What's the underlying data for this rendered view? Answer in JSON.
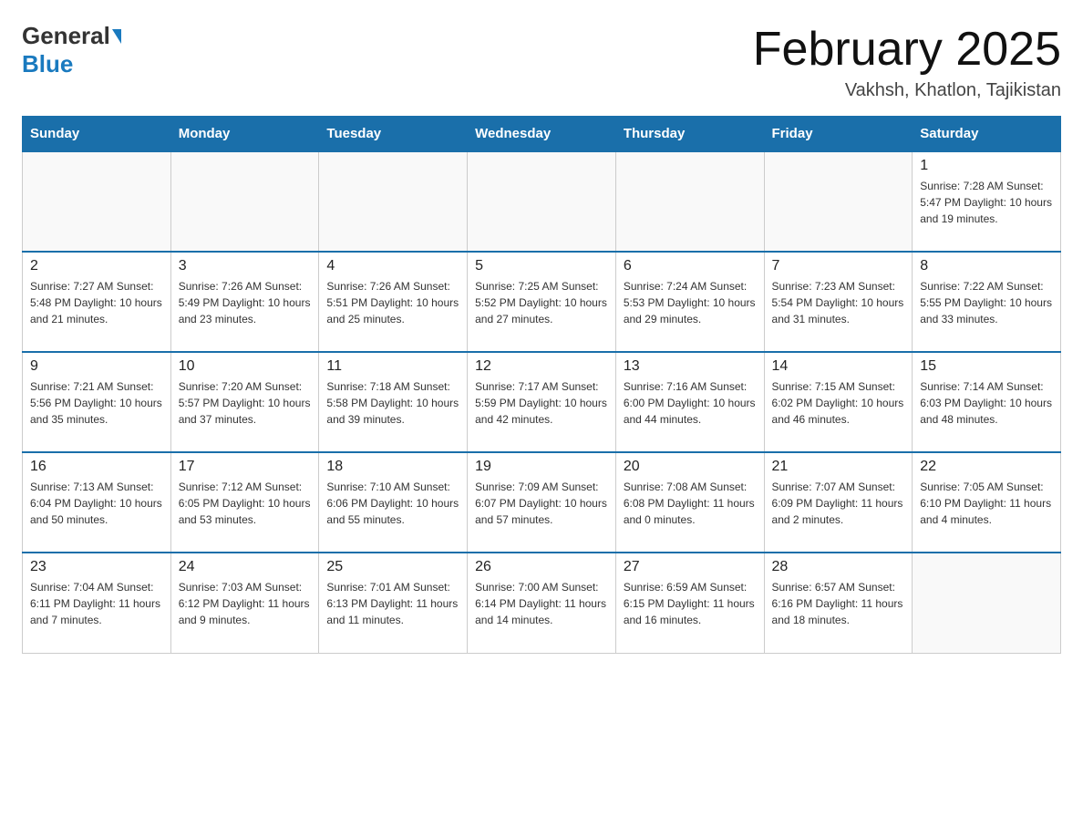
{
  "header": {
    "logo_general": "General",
    "logo_blue": "Blue",
    "title": "February 2025",
    "subtitle": "Vakhsh, Khatlon, Tajikistan"
  },
  "weekdays": [
    "Sunday",
    "Monday",
    "Tuesday",
    "Wednesday",
    "Thursday",
    "Friday",
    "Saturday"
  ],
  "weeks": [
    [
      {
        "day": "",
        "info": ""
      },
      {
        "day": "",
        "info": ""
      },
      {
        "day": "",
        "info": ""
      },
      {
        "day": "",
        "info": ""
      },
      {
        "day": "",
        "info": ""
      },
      {
        "day": "",
        "info": ""
      },
      {
        "day": "1",
        "info": "Sunrise: 7:28 AM\nSunset: 5:47 PM\nDaylight: 10 hours and 19 minutes."
      }
    ],
    [
      {
        "day": "2",
        "info": "Sunrise: 7:27 AM\nSunset: 5:48 PM\nDaylight: 10 hours and 21 minutes."
      },
      {
        "day": "3",
        "info": "Sunrise: 7:26 AM\nSunset: 5:49 PM\nDaylight: 10 hours and 23 minutes."
      },
      {
        "day": "4",
        "info": "Sunrise: 7:26 AM\nSunset: 5:51 PM\nDaylight: 10 hours and 25 minutes."
      },
      {
        "day": "5",
        "info": "Sunrise: 7:25 AM\nSunset: 5:52 PM\nDaylight: 10 hours and 27 minutes."
      },
      {
        "day": "6",
        "info": "Sunrise: 7:24 AM\nSunset: 5:53 PM\nDaylight: 10 hours and 29 minutes."
      },
      {
        "day": "7",
        "info": "Sunrise: 7:23 AM\nSunset: 5:54 PM\nDaylight: 10 hours and 31 minutes."
      },
      {
        "day": "8",
        "info": "Sunrise: 7:22 AM\nSunset: 5:55 PM\nDaylight: 10 hours and 33 minutes."
      }
    ],
    [
      {
        "day": "9",
        "info": "Sunrise: 7:21 AM\nSunset: 5:56 PM\nDaylight: 10 hours and 35 minutes."
      },
      {
        "day": "10",
        "info": "Sunrise: 7:20 AM\nSunset: 5:57 PM\nDaylight: 10 hours and 37 minutes."
      },
      {
        "day": "11",
        "info": "Sunrise: 7:18 AM\nSunset: 5:58 PM\nDaylight: 10 hours and 39 minutes."
      },
      {
        "day": "12",
        "info": "Sunrise: 7:17 AM\nSunset: 5:59 PM\nDaylight: 10 hours and 42 minutes."
      },
      {
        "day": "13",
        "info": "Sunrise: 7:16 AM\nSunset: 6:00 PM\nDaylight: 10 hours and 44 minutes."
      },
      {
        "day": "14",
        "info": "Sunrise: 7:15 AM\nSunset: 6:02 PM\nDaylight: 10 hours and 46 minutes."
      },
      {
        "day": "15",
        "info": "Sunrise: 7:14 AM\nSunset: 6:03 PM\nDaylight: 10 hours and 48 minutes."
      }
    ],
    [
      {
        "day": "16",
        "info": "Sunrise: 7:13 AM\nSunset: 6:04 PM\nDaylight: 10 hours and 50 minutes."
      },
      {
        "day": "17",
        "info": "Sunrise: 7:12 AM\nSunset: 6:05 PM\nDaylight: 10 hours and 53 minutes."
      },
      {
        "day": "18",
        "info": "Sunrise: 7:10 AM\nSunset: 6:06 PM\nDaylight: 10 hours and 55 minutes."
      },
      {
        "day": "19",
        "info": "Sunrise: 7:09 AM\nSunset: 6:07 PM\nDaylight: 10 hours and 57 minutes."
      },
      {
        "day": "20",
        "info": "Sunrise: 7:08 AM\nSunset: 6:08 PM\nDaylight: 11 hours and 0 minutes."
      },
      {
        "day": "21",
        "info": "Sunrise: 7:07 AM\nSunset: 6:09 PM\nDaylight: 11 hours and 2 minutes."
      },
      {
        "day": "22",
        "info": "Sunrise: 7:05 AM\nSunset: 6:10 PM\nDaylight: 11 hours and 4 minutes."
      }
    ],
    [
      {
        "day": "23",
        "info": "Sunrise: 7:04 AM\nSunset: 6:11 PM\nDaylight: 11 hours and 7 minutes."
      },
      {
        "day": "24",
        "info": "Sunrise: 7:03 AM\nSunset: 6:12 PM\nDaylight: 11 hours and 9 minutes."
      },
      {
        "day": "25",
        "info": "Sunrise: 7:01 AM\nSunset: 6:13 PM\nDaylight: 11 hours and 11 minutes."
      },
      {
        "day": "26",
        "info": "Sunrise: 7:00 AM\nSunset: 6:14 PM\nDaylight: 11 hours and 14 minutes."
      },
      {
        "day": "27",
        "info": "Sunrise: 6:59 AM\nSunset: 6:15 PM\nDaylight: 11 hours and 16 minutes."
      },
      {
        "day": "28",
        "info": "Sunrise: 6:57 AM\nSunset: 6:16 PM\nDaylight: 11 hours and 18 minutes."
      },
      {
        "day": "",
        "info": ""
      }
    ]
  ]
}
